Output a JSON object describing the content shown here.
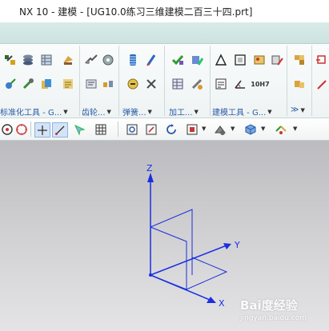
{
  "window": {
    "title": "NX 10 - 建模 - [UG10.0练习三维建模二百三十四.prt]"
  },
  "ribbon": {
    "groups": [
      {
        "label": "标准化工具 - G...",
        "icons": [
          "fastener-assembly-icon",
          "stack-layers-icon",
          "database-icon",
          "weld-assistant-icon",
          "align-icon",
          "part-family-icon"
        ]
      },
      {
        "label": "齿轮...",
        "icons": [
          "gear-tools-icon",
          "gear-edit-icon",
          "gear-info-icon",
          "gear-display-icon"
        ]
      },
      {
        "label": "弹簧...",
        "icons": [
          "spring-icon",
          "spring-edit-icon",
          "spring-delete-icon",
          "spring-info-icon"
        ]
      },
      {
        "label": "加工...",
        "icons": [
          "check-part-icon",
          "edit-fixture-icon",
          "table-icon",
          "drill-icon"
        ]
      },
      {
        "label": "建模工具 - G...",
        "icons": [
          "triangle-icon",
          "frame-icon",
          "image-icon",
          "database-edit-icon",
          "document-icon",
          "measure-icon",
          "tolerance-icon",
          "feature-icon"
        ]
      },
      {
        "label": "",
        "icons": [
          "assembly-icon",
          "constraint-icon"
        ]
      },
      {
        "label": "",
        "icons": [
          "arrow-icon",
          "feature-edit-icon"
        ]
      }
    ],
    "tolerance_label": "10H7"
  },
  "toolbar": {
    "items": [
      "snap-point-icon",
      "circle-target-icon",
      "crosshair-icon",
      "line-tool-icon",
      "quick-pick-icon",
      "grid-icon",
      "fit-view-icon",
      "zoom-icon",
      "rotate-icon",
      "orient-view-icon",
      "render-style-icon",
      "layer-visible-icon",
      "view-triad-icon"
    ]
  },
  "viewport": {
    "axis_labels": {
      "z": "Z",
      "y": "Y",
      "x": "X"
    },
    "colors": {
      "geometry": "#1a2fd6",
      "axis": "#1b2ee0"
    }
  },
  "watermark": {
    "main": "Bai度经验",
    "sub": "jingyan.baidu.com"
  }
}
